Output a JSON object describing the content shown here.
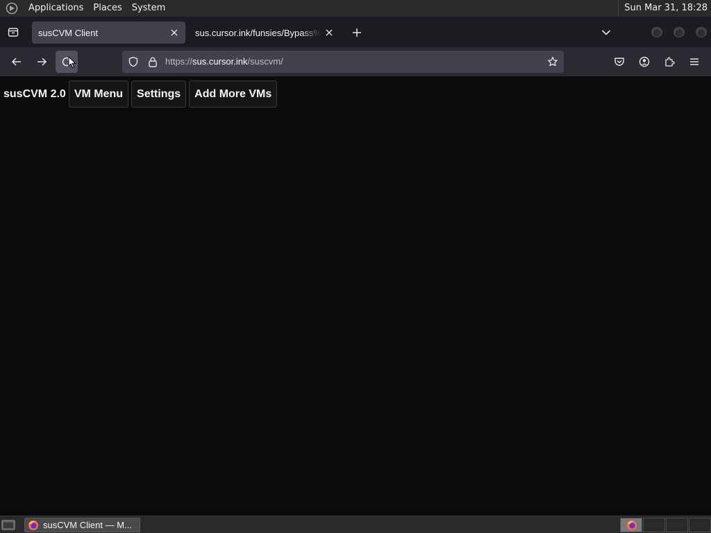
{
  "top_panel": {
    "menus": [
      "Applications",
      "Places",
      "System"
    ],
    "clock": "Sun Mar 31, 18:28"
  },
  "browser": {
    "tabs": [
      {
        "title": "susCVM Client",
        "active": true
      },
      {
        "title": "sus.cursor.ink/funsies/Bypass%",
        "active": false
      }
    ],
    "url": {
      "scheme": "https://",
      "host": "sus.cursor.ink",
      "path": "/suscvm/"
    }
  },
  "page": {
    "app_title": "susCVM 2.0",
    "buttons": [
      "VM Menu",
      "Settings",
      "Add More VMs"
    ]
  },
  "taskbar": {
    "window_label": "susCVM Client — M..."
  },
  "colors": {
    "panel": "#2a2a2b",
    "tabbar": "#1c1b22",
    "navbar": "#2b2a33",
    "urlbar": "#42414d",
    "page_bg": "#0b0b0c"
  }
}
